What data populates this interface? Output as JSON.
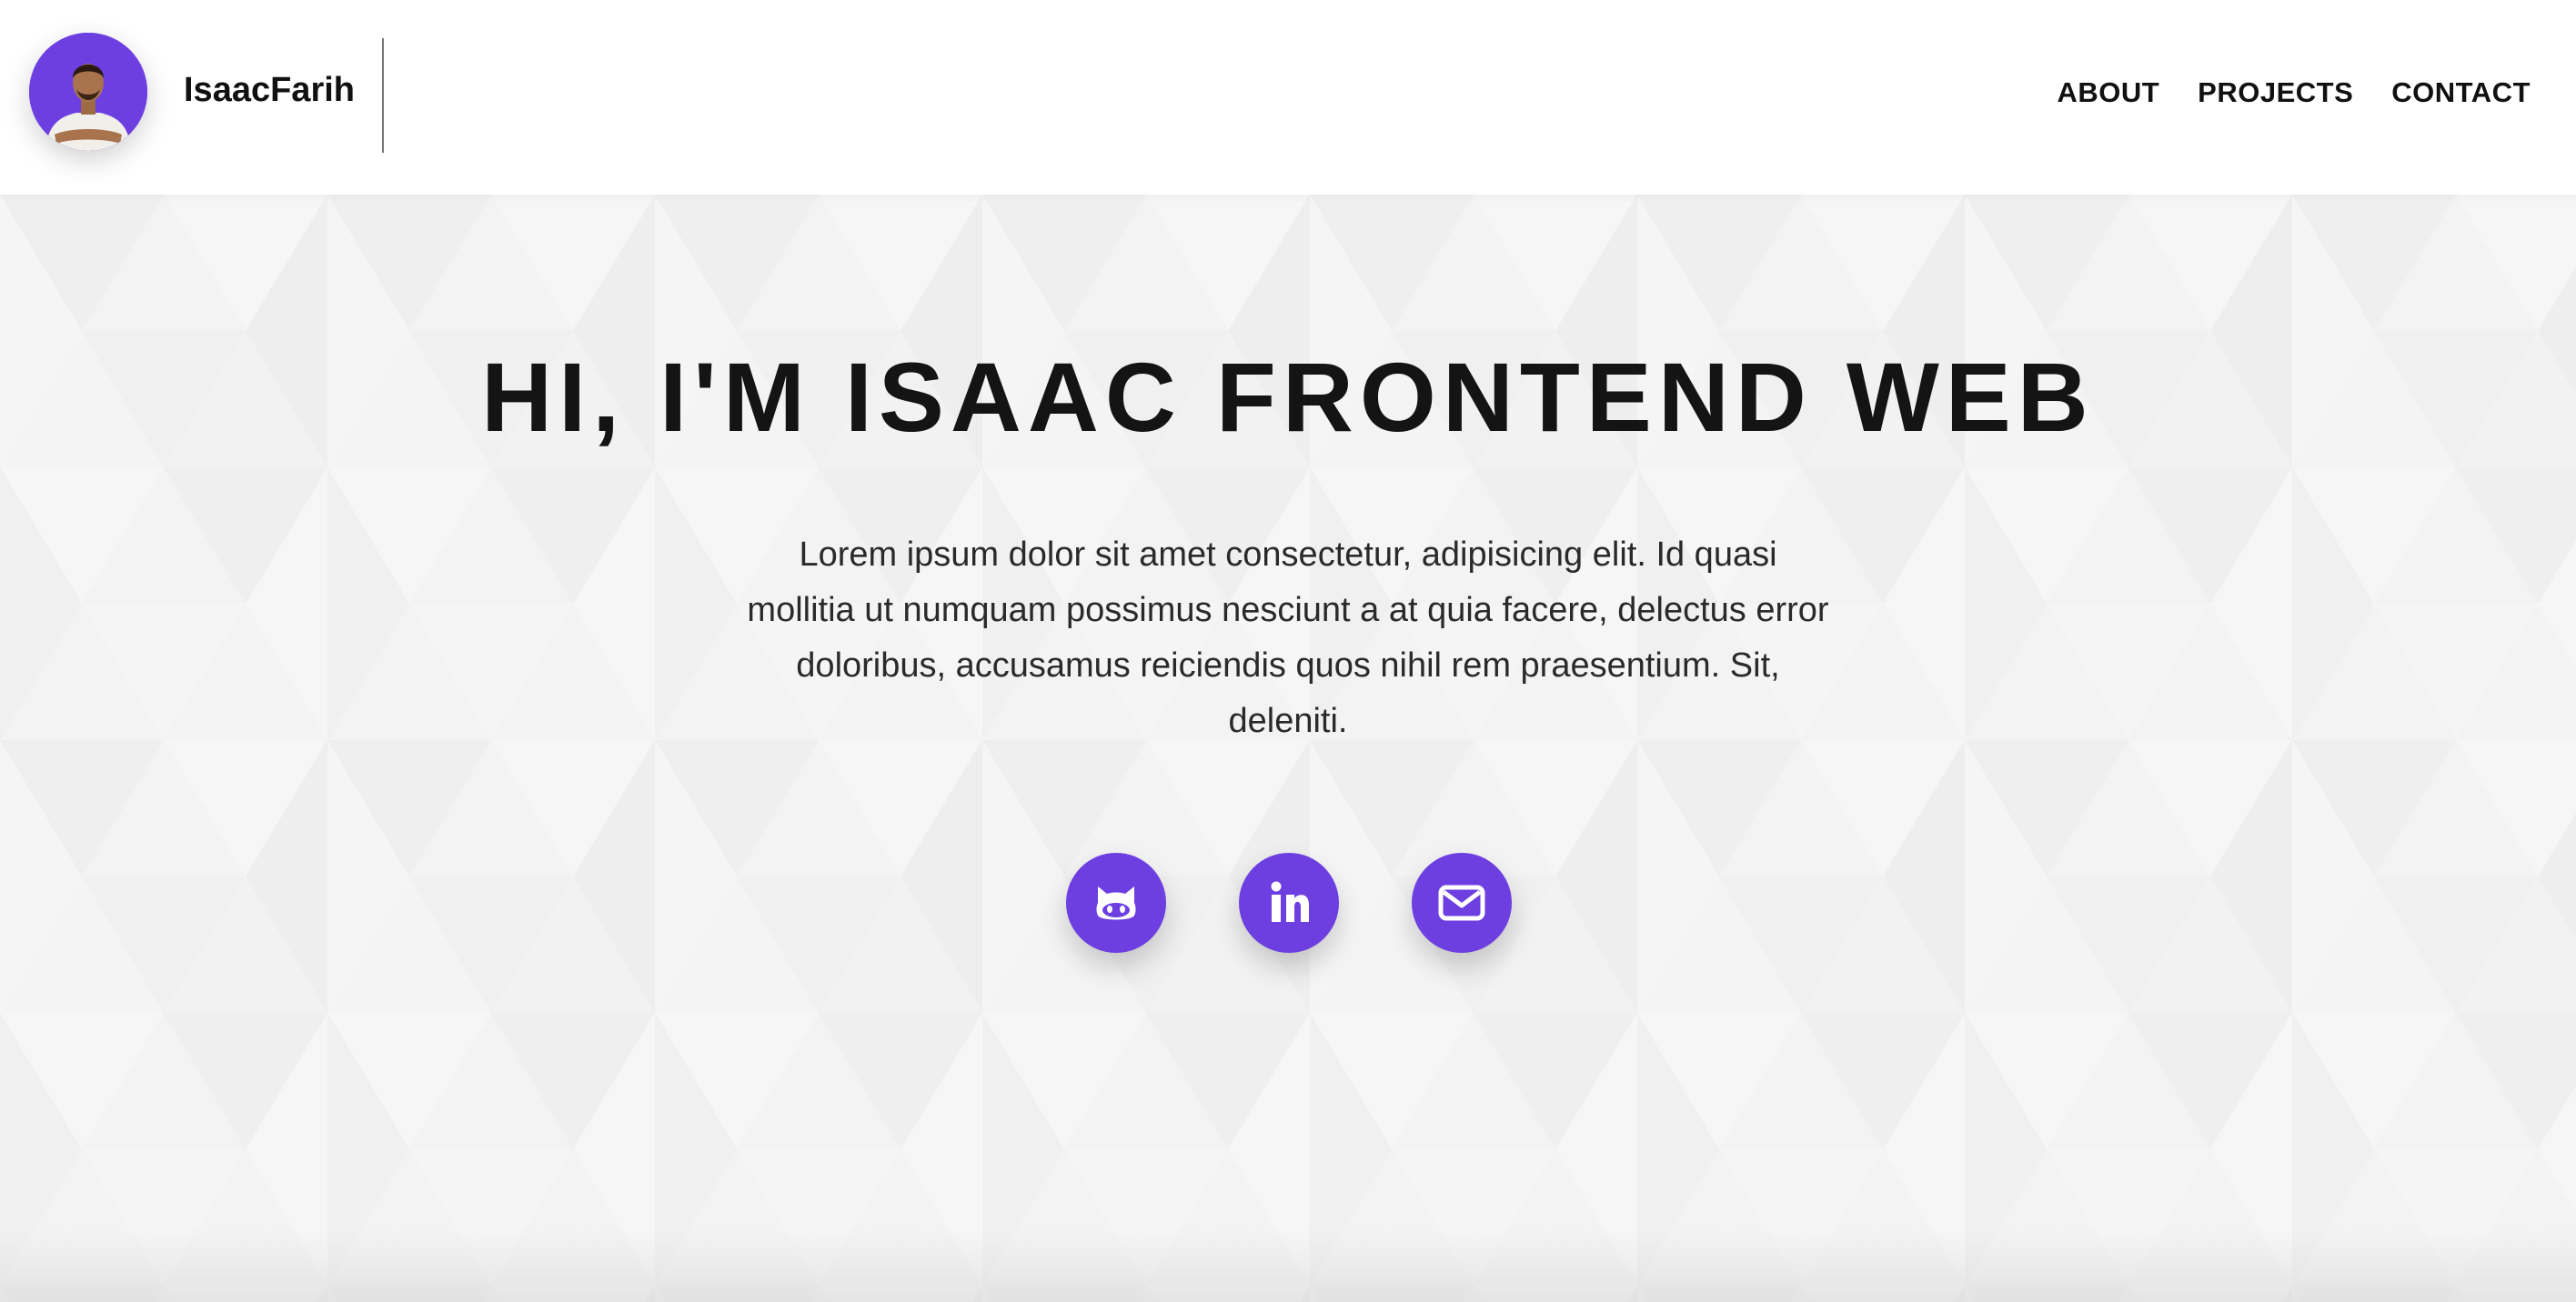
{
  "header": {
    "brand": "IsaacFarih",
    "nav": [
      "ABOUT",
      "PROJECTS",
      "CONTACT"
    ]
  },
  "hero": {
    "title": "HI, I'M ISAAC FRONTEND WEB",
    "description": "Lorem ipsum dolor sit amet consectetur, adipisicing elit. Id quasi mollitia ut numquam possimus nesciunt a at quia facere, delectus error doloribus, accusamus reiciendis quos nihil rem praesentium. Sit, deleniti.",
    "socials": [
      {
        "icon": "github-icon"
      },
      {
        "icon": "linkedin-icon"
      },
      {
        "icon": "email-icon"
      }
    ]
  },
  "colors": {
    "accent": "#6d3fe0",
    "background": "#f4f4f4",
    "text": "#141414"
  }
}
